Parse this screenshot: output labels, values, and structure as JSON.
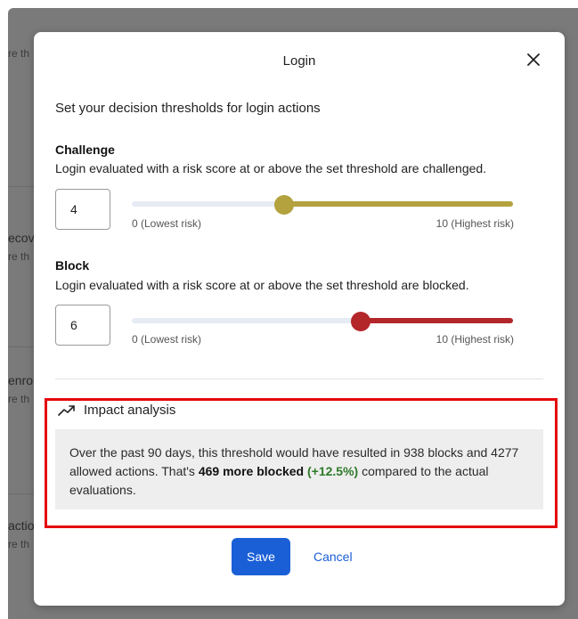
{
  "background": {
    "rows": [
      {
        "title": "",
        "subtitle": "re th"
      },
      {
        "title": "ecov",
        "subtitle": "re th"
      },
      {
        "title": "enro",
        "subtitle": "re th"
      },
      {
        "title": "actio",
        "subtitle": "re th"
      }
    ]
  },
  "modal": {
    "title": "Login",
    "intro": "Set your decision thresholds for login actions",
    "challenge": {
      "title": "Challenge",
      "description": "Login evaluated with a risk score at or above the set threshold are challenged.",
      "value": "4",
      "slider_value": 4,
      "color": "#b3a23e",
      "min_label": "0 (Lowest risk)",
      "max_label": "10 (Highest risk)"
    },
    "block": {
      "title": "Block",
      "description": "Login evaluated with a risk score at or above the set threshold are blocked.",
      "value": "6",
      "slider_value": 6,
      "color": "#b3262a",
      "min_label": "0 (Lowest risk)",
      "max_label": "10 (Highest risk)"
    },
    "impact": {
      "heading": "Impact analysis",
      "text_part1": "Over the past 90 days, this threshold would have resulted in 938 blocks and 4277 allowed actions. That's ",
      "bold": "469 more blocked",
      "pct": "(+12.5%)",
      "text_part2": " compared to the actual evaluations."
    },
    "save_label": "Save",
    "cancel_label": "Cancel"
  }
}
